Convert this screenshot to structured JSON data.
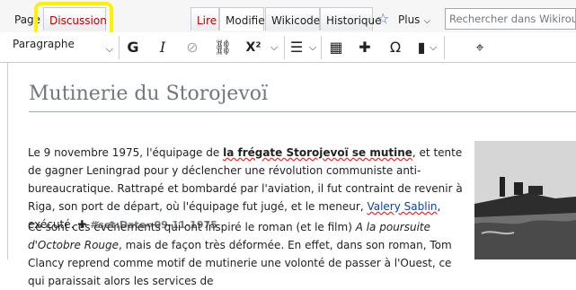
{
  "tabs": {
    "page": "Page",
    "discussion": "Discussion",
    "read": "Lire",
    "edit": "Modifier",
    "wikicode": "Wikicode",
    "history": "Historique",
    "more": "Plus"
  },
  "search": {
    "placeholder": "Rechercher dans Wikirouge"
  },
  "toolbar": {
    "paragraph": "Paragraphe",
    "bold": "G",
    "italic": "I",
    "superscript": "X²",
    "omega": "Ω"
  },
  "article": {
    "title": "Mutinerie du Storojevoï",
    "p1": {
      "a": "Le 9 novembre 1975, l'équipage de ",
      "bold": "la frégate Storojevoï se mutine",
      "b": ", et tente de gagner Leningrad pour y déclencher une révolution communiste anti-bureaucratique. Rattrapé et bombardé par l'aviation, il fut contraint de revenir à Riga, son port de départ, où l'équipage fut jugé, et le meneur, ",
      "link": "Valery Sablin",
      "c": ", exécuté.",
      "template": "#set:Date=09-11-1975"
    },
    "p2": {
      "a": "Ce sont ces événements qui ont inspiré le roman (et le film) ",
      "italic": "A la poursuite d'Octobre Rouge",
      "b": ", mais de façon très déformée. En effet, dans son roman, Tom Clancy reprend comme motif de mutinerie une volonté de passer à l'Ouest, ce qui paraissait alors les services de"
    }
  },
  "colors": {
    "link": "#0645ad",
    "redlink": "#ba0000",
    "highlight": "#fff200",
    "title": "#72777d"
  }
}
